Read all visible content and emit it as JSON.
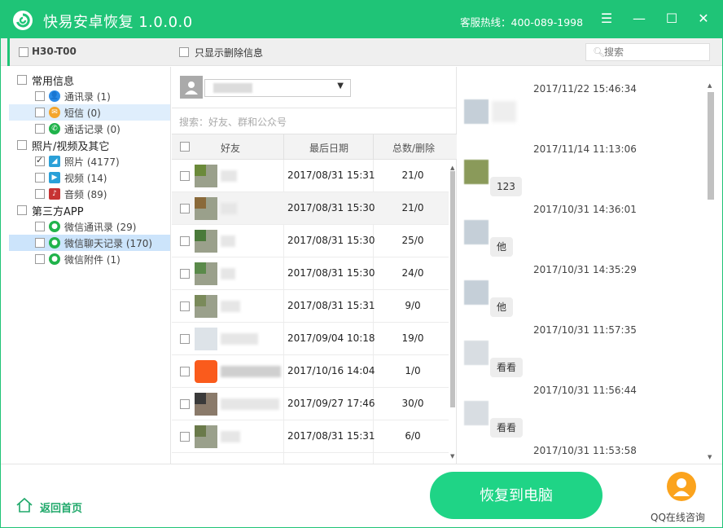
{
  "titlebar": {
    "title": "快易安卓恢复  1.0.0.0",
    "hotline": "客服热线：400-089-1998",
    "menu_icon": "menu-icon",
    "minimize_icon": "minimize-icon",
    "maximize_icon": "maximize-icon",
    "close_icon": "close-icon"
  },
  "toolbar": {
    "device_name": "H30-T00",
    "only_deleted_label": "只显示删除信息",
    "search_placeholder": "搜索"
  },
  "tree": {
    "categories": [
      {
        "label": "常用信息",
        "items": [
          {
            "label": "通讯录 (1)",
            "icon": "contacts-icon",
            "color": "#2b8be6"
          },
          {
            "label": "短信 (0)",
            "icon": "sms-icon",
            "color": "#f4a52b"
          },
          {
            "label": "通话记录 (0)",
            "icon": "phone-icon",
            "color": "#20b34b"
          }
        ]
      },
      {
        "label": "照片/视频及其它",
        "items": [
          {
            "label": "照片 (4177)",
            "icon": "photo-icon",
            "color": "#2aa0d8",
            "checked": true
          },
          {
            "label": "视频 (14)",
            "icon": "video-icon",
            "color": "#2aa0d8"
          },
          {
            "label": "音频 (89)",
            "icon": "audio-icon",
            "color": "#c73333"
          }
        ]
      },
      {
        "label": "第三方APP",
        "items": [
          {
            "label": "微信通讯录 (29)",
            "icon": "wechat-icon",
            "color": "#20b34b"
          },
          {
            "label": "微信聊天记录 (170)",
            "icon": "wechat-icon",
            "color": "#20b34b"
          },
          {
            "label": "微信附件 (1)",
            "icon": "wechat-icon",
            "color": "#20b34b"
          }
        ]
      }
    ]
  },
  "middle": {
    "search_hint": "搜索：好友、群和公众号",
    "columns": {
      "friend": "好友",
      "last_date": "最后日期",
      "total_deleted": "总数/删除"
    },
    "rows": [
      {
        "date": "2017/08/31 15:31",
        "count": "21/0"
      },
      {
        "date": "2017/08/31 15:30",
        "count": "21/0"
      },
      {
        "date": "2017/08/31 15:30",
        "count": "25/0"
      },
      {
        "date": "2017/08/31 15:30",
        "count": "24/0"
      },
      {
        "date": "2017/08/31 15:31",
        "count": "9/0"
      },
      {
        "date": "2017/09/04 10:18",
        "count": "19/0"
      },
      {
        "date": "2017/10/16 14:04",
        "count": "1/0"
      },
      {
        "date": "2017/09/27 17:46",
        "count": "30/0"
      },
      {
        "date": "2017/08/31 15:31",
        "count": "6/0"
      }
    ]
  },
  "chat": {
    "messages": [
      {
        "time": "2017/11/22 15:46:34",
        "text": ""
      },
      {
        "time": "2017/11/14 11:13:06",
        "text": "123"
      },
      {
        "time": "2017/10/31 14:36:01",
        "text": "他"
      },
      {
        "time": "2017/10/31 14:35:29",
        "text": "他"
      },
      {
        "time": "2017/10/31 11:57:35",
        "text": "看看"
      },
      {
        "time": "2017/10/31 11:56:44",
        "text": "看看"
      },
      {
        "time": "2017/10/31 11:53:58",
        "text": ""
      }
    ]
  },
  "footer": {
    "home_label": "返回首页",
    "recover_label": "恢复到电脑",
    "qq_label": "QQ在线咨询"
  }
}
